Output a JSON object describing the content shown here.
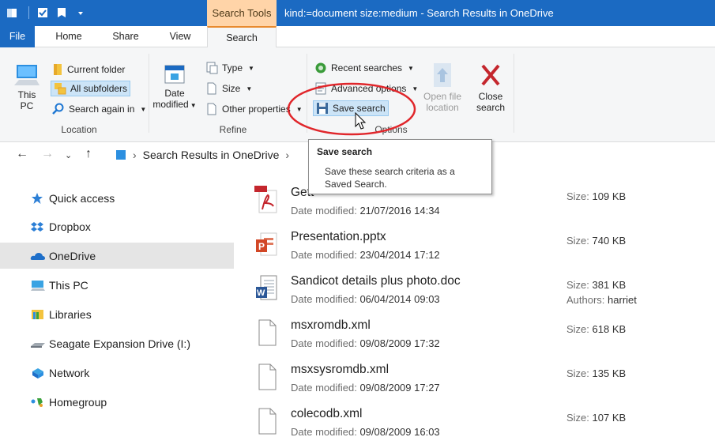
{
  "titlebar": {
    "context_tab": "Search Tools",
    "title": "kind:=document size:medium - Search Results in OneDrive"
  },
  "tabs": {
    "file": "File",
    "home": "Home",
    "share": "Share",
    "view": "View",
    "search": "Search"
  },
  "ribbon": {
    "location": {
      "this_pc": [
        "This",
        "PC"
      ],
      "current_folder": "Current folder",
      "all_subfolders": "All subfolders",
      "search_again": "Search again in",
      "label": "Location"
    },
    "refine": {
      "date_modified": [
        "Date",
        "modified"
      ],
      "type": "Type",
      "size": "Size",
      "other_properties": "Other properties",
      "label": "Refine"
    },
    "options": {
      "recent_searches": "Recent searches",
      "advanced_options": "Advanced options",
      "save_search": "Save search",
      "open_file_location": [
        "Open file",
        "location"
      ],
      "close_search": [
        "Close",
        "search"
      ],
      "label": "Options"
    }
  },
  "address": {
    "crumb": "Search Results in OneDrive"
  },
  "tooltip": {
    "title": "Save search",
    "description": [
      "Save these search criteria as a",
      "Saved Search."
    ]
  },
  "sidebar": {
    "items": [
      {
        "label": "Quick access",
        "icon": "star-icon"
      },
      {
        "label": "Dropbox",
        "icon": "dropbox-icon"
      },
      {
        "label": "OneDrive",
        "icon": "cloud-icon"
      },
      {
        "label": "This PC",
        "icon": "computer-icon"
      },
      {
        "label": "Libraries",
        "icon": "library-icon"
      },
      {
        "label": "Seagate Expansion Drive (I:)",
        "icon": "drive-icon"
      },
      {
        "label": "Network",
        "icon": "network-icon"
      },
      {
        "label": "Homegroup",
        "icon": "homegroup-icon"
      }
    ]
  },
  "results": {
    "date_label": "Date modified:",
    "size_label": "Size:",
    "authors_label": "Authors:",
    "files": [
      {
        "name": "Gett",
        "date": "21/07/2016 14:34",
        "size": "109 KB",
        "icon": "pdf-icon"
      },
      {
        "name": "Presentation.pptx",
        "date": "23/04/2014 17:12",
        "size": "740 KB",
        "icon": "powerpoint-icon"
      },
      {
        "name": "Sandicot details plus photo.doc",
        "date": "06/04/2014 09:03",
        "size": "381 KB",
        "authors": "harriet",
        "icon": "word-icon"
      },
      {
        "name": "msxromdb.xml",
        "date": "09/08/2009 17:32",
        "size": "618 KB",
        "icon": "file-icon"
      },
      {
        "name": "msxsysromdb.xml",
        "date": "09/08/2009 17:27",
        "size": "135 KB",
        "icon": "file-icon"
      },
      {
        "name": "colecodb.xml",
        "date": "09/08/2009 16:03",
        "size": "107 KB",
        "icon": "file-icon"
      }
    ]
  },
  "colors": {
    "titlebar": "#1b6ac2",
    "context_tab": "#ffd4a8",
    "highlight_circle": "#e0262b",
    "selected": "#cce4f7"
  }
}
